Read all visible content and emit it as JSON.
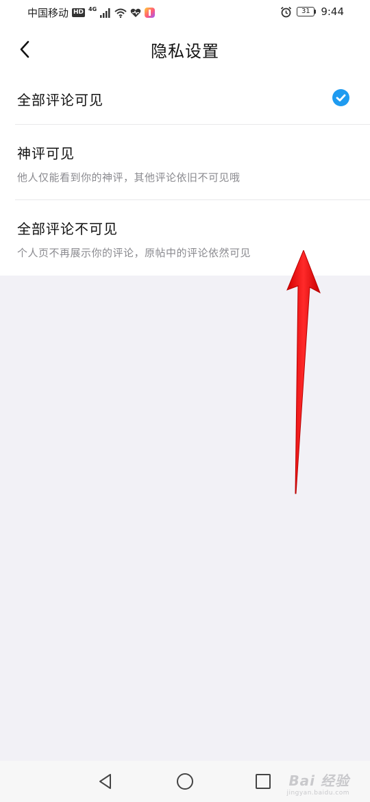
{
  "status_bar": {
    "carrier": "中国移动",
    "hd": "HD",
    "network": "4G",
    "battery": "31",
    "time": "9:44"
  },
  "header": {
    "title": "隐私设置"
  },
  "options": [
    {
      "title": "全部评论可见",
      "description": "",
      "selected": true
    },
    {
      "title": "神评可见",
      "description": "他人仅能看到你的神评，其他评论依旧不可见哦",
      "selected": false
    },
    {
      "title": "全部评论不可见",
      "description": "个人页不再展示你的评论，原帖中的评论依然可见",
      "selected": false
    }
  ],
  "colors": {
    "accent": "#1f9bf0",
    "arrow": "#ee1111",
    "page_background": "#f2f1f6"
  },
  "watermark": {
    "main": "Bai 经验",
    "sub": "jingyan.baidu.com"
  }
}
